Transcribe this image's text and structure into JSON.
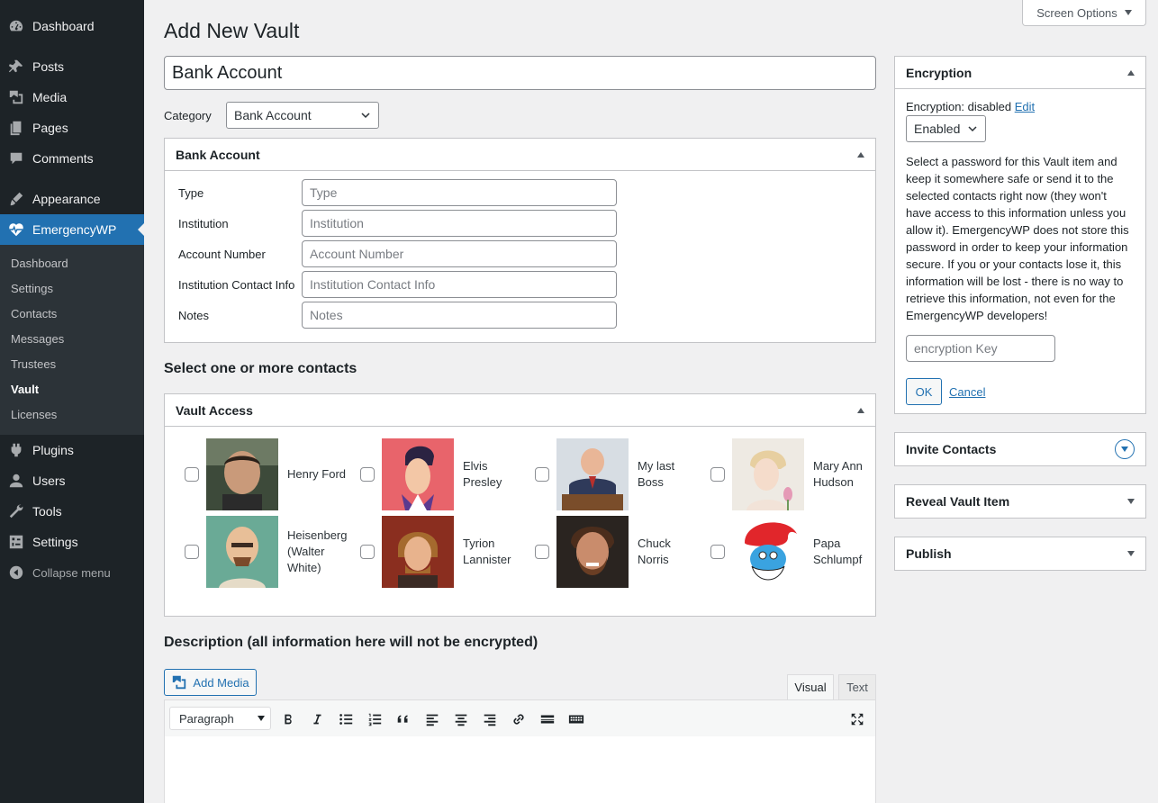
{
  "sidebar": {
    "items": [
      {
        "label": "Dashboard",
        "icon": "dashboard-icon"
      },
      {
        "label": "Posts",
        "icon": "pin-icon"
      },
      {
        "label": "Media",
        "icon": "media-icon"
      },
      {
        "label": "Pages",
        "icon": "pages-icon"
      },
      {
        "label": "Comments",
        "icon": "comment-icon"
      },
      {
        "label": "Appearance",
        "icon": "brush-icon"
      },
      {
        "label": "EmergencyWP",
        "icon": "heart-pulse-icon"
      },
      {
        "label": "Plugins",
        "icon": "plugin-icon"
      },
      {
        "label": "Users",
        "icon": "user-icon"
      },
      {
        "label": "Tools",
        "icon": "wrench-icon"
      },
      {
        "label": "Settings",
        "icon": "settings-icon"
      },
      {
        "label": "Collapse menu",
        "icon": "collapse-icon"
      }
    ],
    "submenu": [
      "Dashboard",
      "Settings",
      "Contacts",
      "Messages",
      "Trustees",
      "Vault",
      "Licenses"
    ],
    "current_submenu": "Vault"
  },
  "screen_options": "Screen Options",
  "page_title": "Add New Vault",
  "title_value": "Bank Account",
  "category": {
    "label": "Category",
    "selected": "Bank Account"
  },
  "bank_box": {
    "title": "Bank Account",
    "fields": [
      {
        "label": "Type",
        "placeholder": "Type"
      },
      {
        "label": "Institution",
        "placeholder": "Institution"
      },
      {
        "label": "Account Number",
        "placeholder": "Account Number"
      },
      {
        "label": "Institution Contact Info",
        "placeholder": "Institution Contact Info"
      },
      {
        "label": "Notes",
        "placeholder": "Notes"
      }
    ]
  },
  "contacts_heading": "Select one or more contacts",
  "vault_access": {
    "title": "Vault Access",
    "contacts": [
      {
        "name": "Henry Ford"
      },
      {
        "name": "Elvis Presley"
      },
      {
        "name": "My last Boss"
      },
      {
        "name": "Mary Ann Hudson"
      },
      {
        "name": "Heisenberg (Walter White)"
      },
      {
        "name": "Tyrion Lannister"
      },
      {
        "name": "Chuck Norris"
      },
      {
        "name": "Papa Schlumpf"
      }
    ]
  },
  "description_heading": "Description (all information here will not be encrypted)",
  "editor": {
    "add_media": "Add Media",
    "tab_visual": "Visual",
    "tab_text": "Text",
    "format": "Paragraph"
  },
  "encryption": {
    "title": "Encryption",
    "status_label": "Encryption: disabled",
    "edit_link": "Edit",
    "select_value": "Enabled",
    "description": "Select a password for this Vault item and keep it somewhere safe or send it to the selected contacts right now (they won't have access to this information unless you allow it). EmergencyWP does not store this password in order to keep your information secure. If you or your contacts lose it, this information will be lost - there is no way to retrieve this information, not even for the EmergencyWP developers!",
    "key_placeholder": "encryption Key",
    "ok": "OK",
    "cancel": "Cancel"
  },
  "side_boxes": {
    "invite": "Invite Contacts",
    "reveal": "Reveal Vault Item",
    "publish": "Publish"
  },
  "colors": {
    "sidebar_bg": "#1d2327",
    "accent": "#2271b1",
    "page_bg": "#f0f0f1"
  }
}
